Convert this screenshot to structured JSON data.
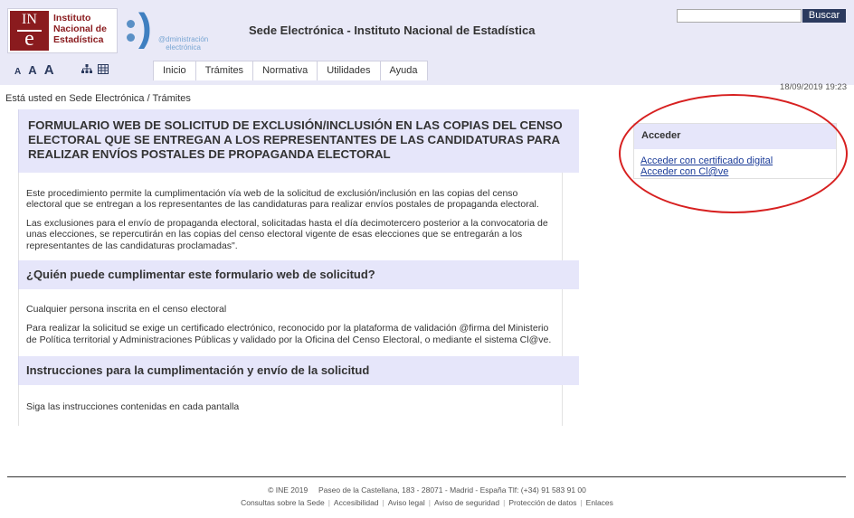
{
  "header": {
    "logo": {
      "mark_top": "IN",
      "mark_bottom": "e",
      "line1": "Instituto",
      "line2": "Nacional de",
      "line3": "Estadística"
    },
    "admin_logo": {
      "line1": "@dministración",
      "line2": "electrónica"
    },
    "site_title": "Sede Electrónica - Instituto Nacional de Estadística",
    "search": {
      "value": "",
      "button_label": "Buscar"
    },
    "font_sizes": [
      "A",
      "A",
      "A"
    ],
    "tool_icons": [
      "sitemap-icon",
      "keyboard-icon"
    ]
  },
  "nav": {
    "tabs": [
      "Inicio",
      "Trámites",
      "Normativa",
      "Utilidades",
      "Ayuda"
    ]
  },
  "datetime": "18/09/2019 19:23",
  "breadcrumb": {
    "prefix": "Está usted en",
    "home": "Sede Electrónica",
    "separator": "/",
    "current": "Trámites"
  },
  "main": {
    "title": "FORMULARIO WEB DE SOLICITUD DE EXCLUSIÓN/INCLUSIÓN EN LAS COPIAS DEL CENSO ELECTORAL QUE SE ENTREGAN A LOS REPRESENTANTES DE LAS CANDIDATURAS PARA REALIZAR ENVÍOS POSTALES DE PROPAGANDA ELECTORAL",
    "intro_p1": "Este procedimiento permite la cumplimentación vía web de la solicitud de exclusión/inclusión en las copias del censo electoral que se entregan a los representantes de las candidaturas para realizar envíos postales de propaganda electoral.",
    "intro_p2": "Las exclusiones para el envío de propaganda electoral, solicitadas hasta el día decimotercero posterior a la convocatoria de unas elecciones, se repercutirán en las copias del censo electoral vigente de esas elecciones que se entregarán a los representantes de las candidaturas proclamadas\".",
    "who_heading": "¿Quién puede cumplimentar este formulario web de solicitud?",
    "who_p1": "Cualquier persona inscrita en el censo electoral",
    "who_p2": "Para realizar la solicitud se exige un certificado electrónico, reconocido por la plataforma de validación @firma del Ministerio de Política territorial y Administraciones Públicas y validado por la Oficina del Censo Electoral, o mediante el sistema Cl@ve.",
    "instr_heading": "Instrucciones para la cumplimentación y envío de la solicitud",
    "instr_p1": "Siga las instrucciones contenidas en cada pantalla"
  },
  "sidebar": {
    "heading": "Acceder",
    "links": [
      "Acceder con certificado digital",
      "Acceder con Cl@ve"
    ]
  },
  "annotation": {
    "highlight_color": "#d72020"
  },
  "footer": {
    "line1": "© INE 2019     Paseo de la Castellana, 183 - 28071 - Madrid - España Tlf: (+34) 91 583 91 00",
    "links": [
      "Consultas sobre la Sede",
      "Accesibilidad",
      "Aviso legal",
      "Aviso de seguridad",
      "Protección de datos",
      "Enlaces"
    ]
  },
  "colors": {
    "header_bg": "#e9e9f7",
    "heading_bg": "#e6e6fa",
    "brand_red": "#8a1b1e",
    "link": "#1a3b98",
    "search_btn": "#2b3a5e"
  }
}
